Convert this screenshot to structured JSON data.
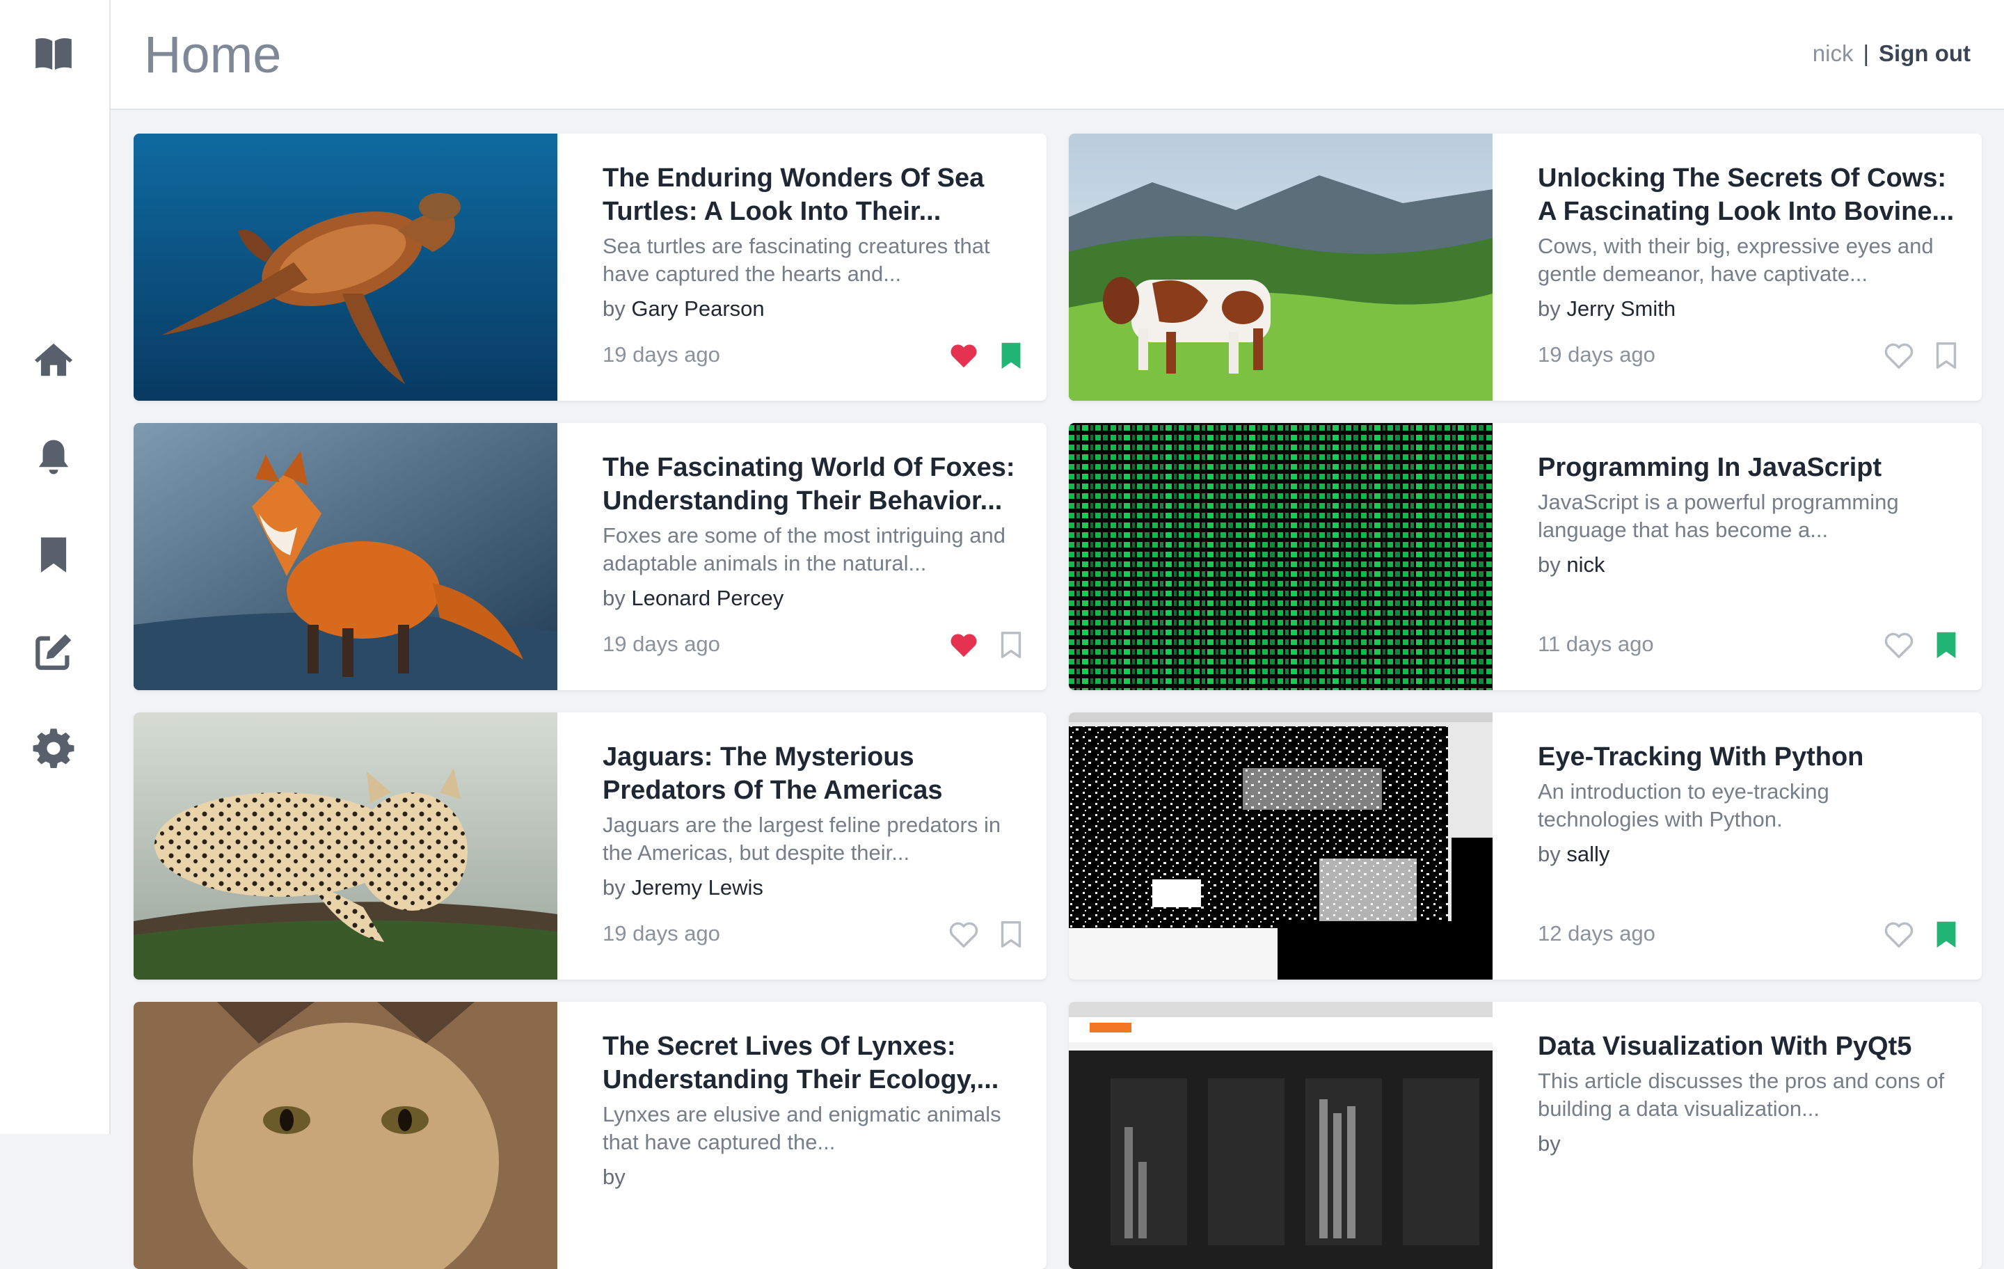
{
  "sidebar": {
    "icons": [
      "book-logo-icon",
      "home-icon",
      "bell-icon",
      "bookmark-icon",
      "edit-icon",
      "gear-icon"
    ],
    "color": "#58606c"
  },
  "header": {
    "title": "Home"
  },
  "user": {
    "name": "nick",
    "separator": "|",
    "signout_label": "Sign out"
  },
  "colors": {
    "heart_active": "#e53250",
    "bookmark_active": "#22b573",
    "inactive": "#b8bec6"
  },
  "articles": [
    {
      "title": "The Enduring Wonders Of Sea Turtles: A Look Into Their...",
      "excerpt": "Sea turtles are fascinating creatures that have captured the hearts and...",
      "by": "by",
      "author": "Gary Pearson",
      "date": "19 days ago",
      "image": "sea-turtle-photo",
      "liked": true,
      "bookmarked": true
    },
    {
      "title": "Unlocking The Secrets Of Cows: A Fascinating Look Into Bovine...",
      "excerpt": "Cows, with their big, expressive eyes and gentle demeanor, have captivate...",
      "by": "by",
      "author": "Jerry Smith",
      "date": "19 days ago",
      "image": "cow-landscape-photo",
      "liked": false,
      "bookmarked": false
    },
    {
      "title": "The Fascinating World Of Foxes: Understanding Their Behavior...",
      "excerpt": "Foxes are some of the most intriguing and adaptable animals in the natural...",
      "by": "by",
      "author": "Leonard Percey",
      "date": "19 days ago",
      "image": "fox-photo",
      "liked": true,
      "bookmarked": false
    },
    {
      "title": "Programming In JavaScript",
      "excerpt": "JavaScript is a powerful programming language that has become a...",
      "by": "by",
      "author": "nick",
      "date": "11 days ago",
      "image": "green-code-matrix-image",
      "liked": false,
      "bookmarked": true
    },
    {
      "title": "Jaguars: The Mysterious Predators Of The Americas",
      "excerpt": "Jaguars are the largest feline predators in the Americas, but despite their...",
      "by": "by",
      "author": "Jeremy Lewis",
      "date": "19 days ago",
      "image": "jaguar-photo",
      "liked": false,
      "bookmarked": false
    },
    {
      "title": "Eye-Tracking With Python",
      "excerpt": "An introduction to eye-tracking technologies with Python.",
      "by": "by",
      "author": "sally",
      "date": "12 days ago",
      "image": "eye-tracking-screenshot",
      "liked": false,
      "bookmarked": true
    },
    {
      "title": "The Secret Lives Of Lynxes: Understanding Their Ecology,...",
      "excerpt": "Lynxes are elusive and enigmatic animals that have captured the...",
      "by": "by",
      "author": "",
      "date": "",
      "image": "lynx-photo",
      "liked": false,
      "bookmarked": false
    },
    {
      "title": "Data Visualization With PyQt5",
      "excerpt": "This article discusses the pros and cons of building a data visualization...",
      "by": "by",
      "author": "",
      "date": "",
      "image": "pyqt5-jupyter-screenshot",
      "liked": false,
      "bookmarked": false
    }
  ]
}
